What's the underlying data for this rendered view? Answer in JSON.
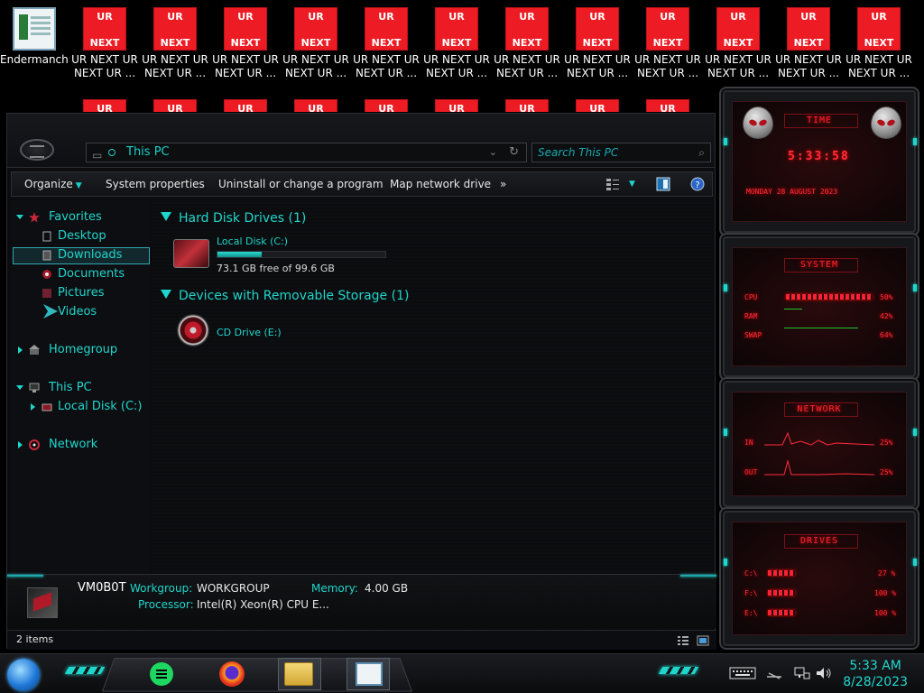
{
  "desktop": {
    "icons_row1": [
      {
        "label_l1": "Endermanch...",
        "label_l2": "",
        "type": "ender"
      },
      {
        "label_l1": "UR NEXT UR",
        "label_l2": "NEXT UR ...",
        "type": "ur",
        "img_top": "UR",
        "img_bottom": "NEXT"
      },
      {
        "label_l1": "UR NEXT UR",
        "label_l2": "NEXT UR ...",
        "type": "ur",
        "img_top": "UR",
        "img_bottom": "NEXT"
      },
      {
        "label_l1": "UR NEXT UR",
        "label_l2": "NEXT UR ...",
        "type": "ur",
        "img_top": "UR",
        "img_bottom": "NEXT"
      },
      {
        "label_l1": "UR NEXT UR",
        "label_l2": "NEXT UR ...",
        "type": "ur",
        "img_top": "UR",
        "img_bottom": "NEXT"
      },
      {
        "label_l1": "UR NEXT UR",
        "label_l2": "NEXT UR ...",
        "type": "ur",
        "img_top": "UR",
        "img_bottom": "NEXT"
      },
      {
        "label_l1": "UR NEXT UR",
        "label_l2": "NEXT UR ...",
        "type": "ur",
        "img_top": "UR",
        "img_bottom": "NEXT"
      },
      {
        "label_l1": "UR NEXT UR",
        "label_l2": "NEXT UR ...",
        "type": "ur",
        "img_top": "UR",
        "img_bottom": "NEXT"
      },
      {
        "label_l1": "UR NEXT UR",
        "label_l2": "NEXT UR ...",
        "type": "ur",
        "img_top": "UR",
        "img_bottom": "NEXT"
      },
      {
        "label_l1": "UR NEXT UR",
        "label_l2": "NEXT UR ...",
        "type": "ur",
        "img_top": "UR",
        "img_bottom": "NEXT"
      },
      {
        "label_l1": "UR NEXT UR",
        "label_l2": "NEXT UR ...",
        "type": "ur",
        "img_top": "UR",
        "img_bottom": "NEXT"
      },
      {
        "label_l1": "UR NEXT UR",
        "label_l2": "NEXT UR ...",
        "type": "ur",
        "img_top": "UR",
        "img_bottom": "NEXT"
      },
      {
        "label_l1": "UR NEXT UR",
        "label_l2": "NEXT UR ...",
        "type": "ur",
        "img_top": "UR",
        "img_bottom": "NEXT"
      }
    ],
    "icons_row2_partial": [
      "UR",
      "UR",
      "UR",
      "UR",
      "UR",
      "UR",
      "UR",
      "UR",
      "UR"
    ]
  },
  "explorer": {
    "address": "This PC",
    "search_placeholder": "Search This PC",
    "toolbar": {
      "organize": "Organize",
      "system_properties": "System properties",
      "uninstall": "Uninstall or change a program",
      "map_drive": "Map network drive",
      "more": "»"
    },
    "nav": {
      "favorites": "Favorites",
      "desktop": "Desktop",
      "downloads": "Downloads",
      "documents": "Documents",
      "pictures": "Pictures",
      "videos": "Videos",
      "homegroup": "Homegroup",
      "this_pc": "This PC",
      "local_disk": "Local Disk (C:)",
      "network": "Network"
    },
    "groups": {
      "hdd_header": "Hard Disk Drives (1)",
      "removable_header": "Devices with Removable Storage (1)"
    },
    "drives": {
      "c_name": "Local Disk (C:)",
      "c_free": "73.1 GB free of 99.6 GB",
      "c_used_fraction": 0.266,
      "e_name": "CD Drive (E:)"
    },
    "details": {
      "computer_name": "VM0B0T",
      "workgroup_label": "Workgroup:",
      "workgroup_value": "WORKGROUP",
      "memory_label": "Memory:",
      "memory_value": "4.00 GB",
      "processor_label": "Processor:",
      "processor_value": "Intel(R) Xeon(R) CPU E..."
    },
    "status": "2 items"
  },
  "gadgets": {
    "time_title": "TIME",
    "time_value": "5:33:58",
    "date_value": "MONDAY 28 AUGUST 2023",
    "system_title": "SYSTEM",
    "cpu_label": "CPU",
    "cpu_value": "50%",
    "ram_label": "RAM",
    "ram_value": "42%",
    "swap_label": "SWAP",
    "swap_value": "64%",
    "network_title": "NETWORK",
    "in_label": "IN",
    "in_value": "25%",
    "out_label": "OUT",
    "out_value": "25%",
    "drives_title": "DRIVES",
    "drive_c_label": "C:\\",
    "drive_c_value": "27 %",
    "drive_f_label": "F:\\",
    "drive_f_value": "100 %",
    "drive_e_label": "E:\\",
    "drive_e_value": "100 %"
  },
  "taskbar": {
    "time": "5:33 AM",
    "date": "8/28/2023"
  },
  "colors": {
    "accent_cyan": "#1fd6cc",
    "accent_red": "#ff2636",
    "ur_red": "#ed1c24"
  }
}
